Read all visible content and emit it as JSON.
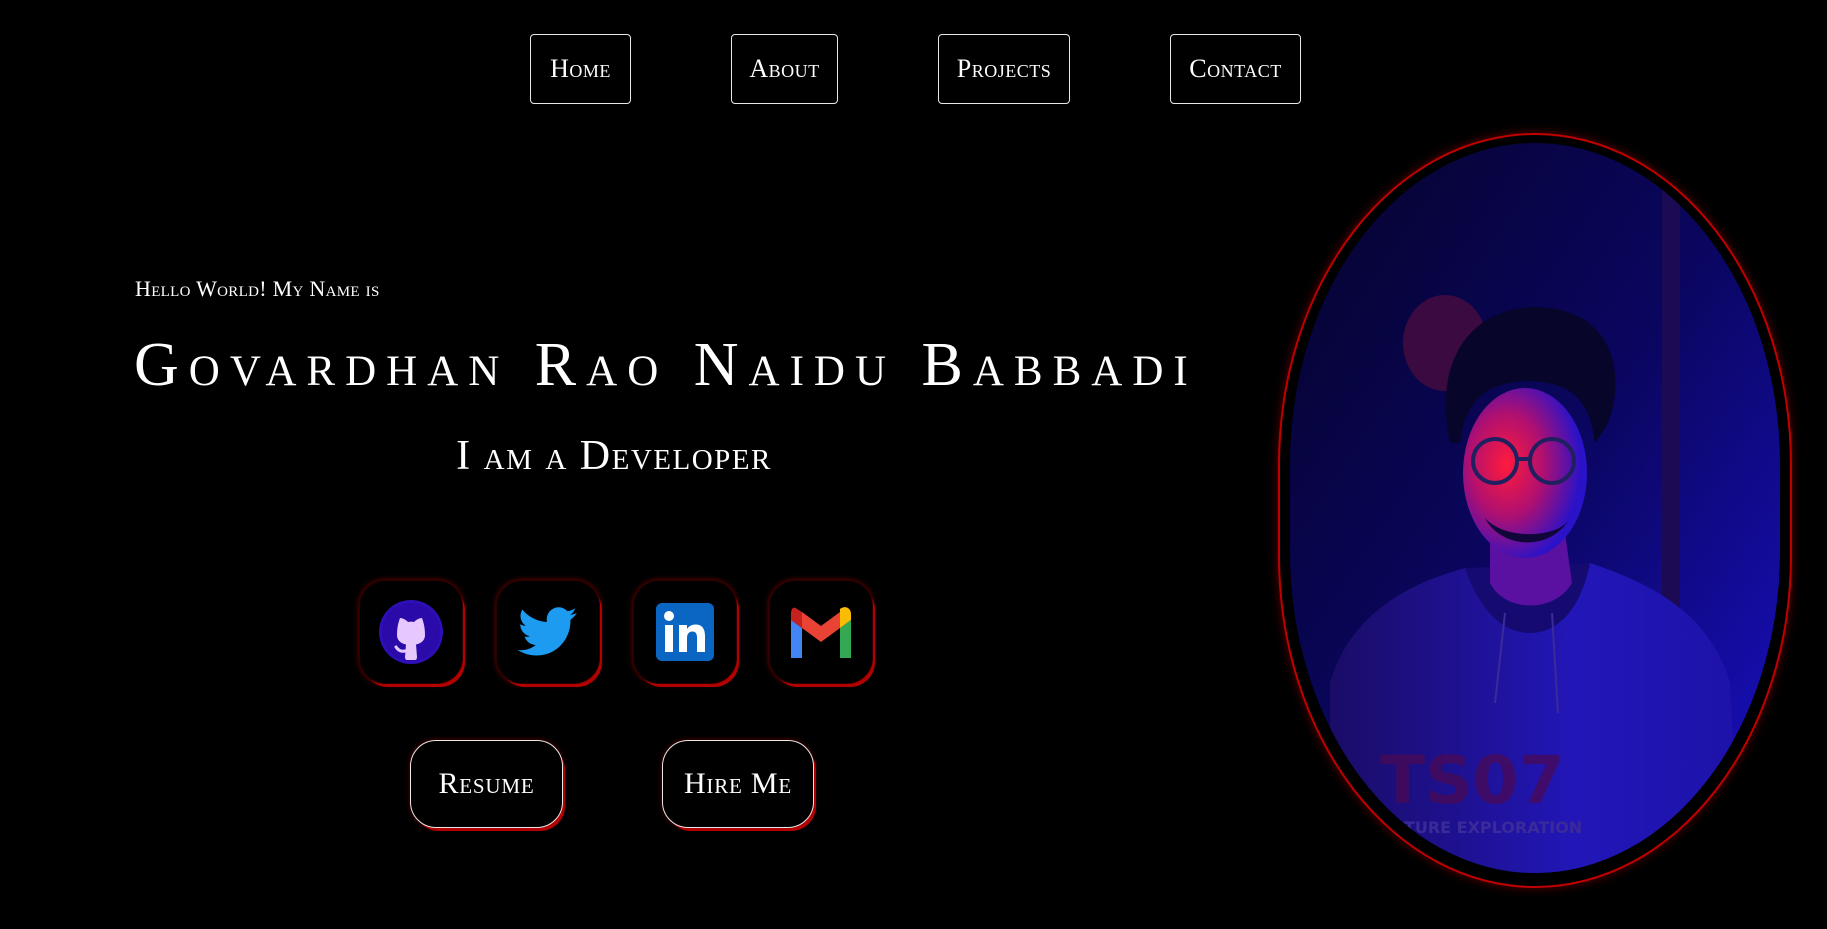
{
  "nav": {
    "items": [
      {
        "label": "Home"
      },
      {
        "label": "About"
      },
      {
        "label": "Projects"
      },
      {
        "label": "Contact"
      }
    ]
  },
  "hero": {
    "greeting": "Hello World! My Name is",
    "name": "Govardhan Rao Naidu Babbadi",
    "role": "I am a Developer"
  },
  "social": {
    "items": [
      {
        "icon": "github-icon"
      },
      {
        "icon": "twitter-icon"
      },
      {
        "icon": "linkedin-icon"
      },
      {
        "icon": "gmail-icon"
      }
    ]
  },
  "actions": {
    "resume_label": "Resume",
    "hire_label": "Hire Me"
  },
  "portrait": {
    "shirt_text": "TS07",
    "shirt_subtext": "FUTURE EXPLORATION"
  },
  "colors": {
    "background": "#000000",
    "accent": "#c00000",
    "text": "#ffffff",
    "portrait_blue": "#1a10c8",
    "portrait_red": "#ff1a3c"
  }
}
